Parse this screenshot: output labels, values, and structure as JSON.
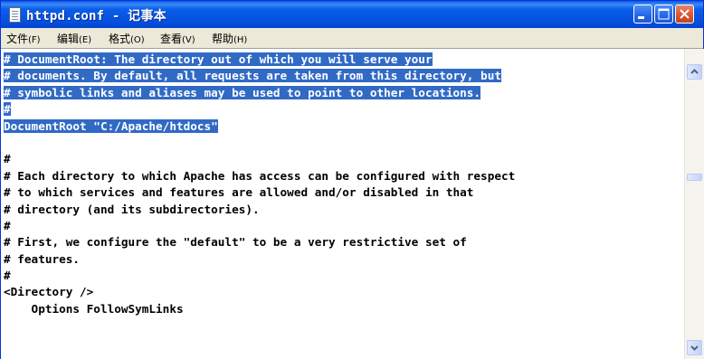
{
  "window": {
    "title": "httpd.conf - 记事本"
  },
  "menubar": {
    "items": [
      {
        "label": "文件",
        "key": "(F)"
      },
      {
        "label": "编辑",
        "key": "(E)"
      },
      {
        "label": "格式",
        "key": "(O)"
      },
      {
        "label": "查看",
        "key": "(V)"
      },
      {
        "label": "帮助",
        "key": "(H)"
      }
    ]
  },
  "editor": {
    "selected_lines": [
      "# DocumentRoot: The directory out of which you will serve your",
      "# documents. By default, all requests are taken from this directory, but",
      "# symbolic links and aliases may be used to point to other locations.",
      "#",
      "DocumentRoot \"C:/Apache/htdocs\""
    ],
    "lines": [
      "",
      "#",
      "# Each directory to which Apache has access can be configured with respect",
      "# to which services and features are allowed and/or disabled in that",
      "# directory (and its subdirectories).",
      "#",
      "# First, we configure the \"default\" to be a very restrictive set of",
      "# features.",
      "#",
      "<Directory />",
      "    Options FollowSymLinks"
    ]
  },
  "icons": {
    "app": "notepad-icon",
    "minimize": "minimize-icon",
    "maximize": "maximize-icon",
    "close": "close-icon",
    "scroll_up": "scroll-up-arrow-icon",
    "scroll_down": "scroll-down-arrow-icon"
  },
  "colors": {
    "titlebar": "#0553e0",
    "selection": "#316ac5",
    "close_button": "#d9532e"
  }
}
